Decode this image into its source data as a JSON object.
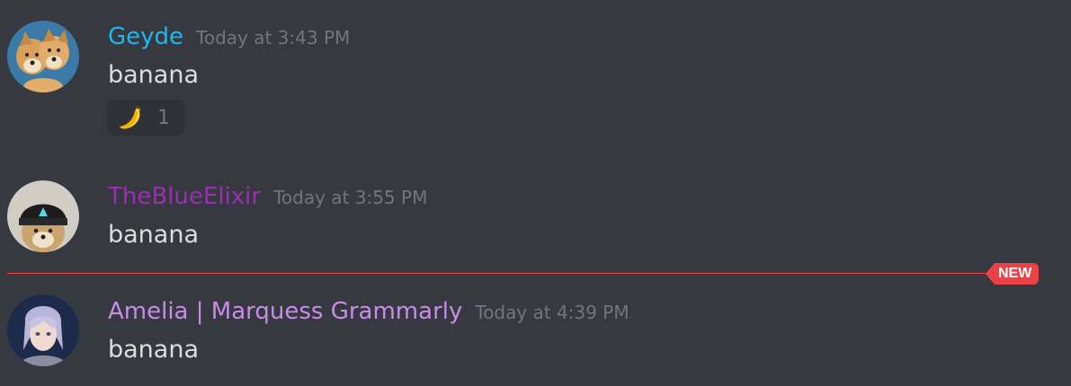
{
  "messages": [
    {
      "author": "Geyde",
      "author_color": "#1fb7f0",
      "timestamp": "Today at 3:43 PM",
      "content": "banana",
      "avatar": "doge-two-heads-avatar",
      "reactions": [
        {
          "emoji": "banana-emoji",
          "count": "1"
        }
      ]
    },
    {
      "author": "TheBlueElixir",
      "author_color": "#9b2fb0",
      "timestamp": "Today at 3:55 PM",
      "content": "banana",
      "avatar": "shiba-beanie-avatar"
    },
    {
      "author": "Amelia | Marquess Grammarly",
      "author_color": "#c88ce8",
      "timestamp": "Today at 4:39 PM",
      "content": "banana",
      "avatar": "anime-character-avatar"
    }
  ],
  "new_divider": {
    "label": "NEW",
    "color": "#ed4245"
  }
}
